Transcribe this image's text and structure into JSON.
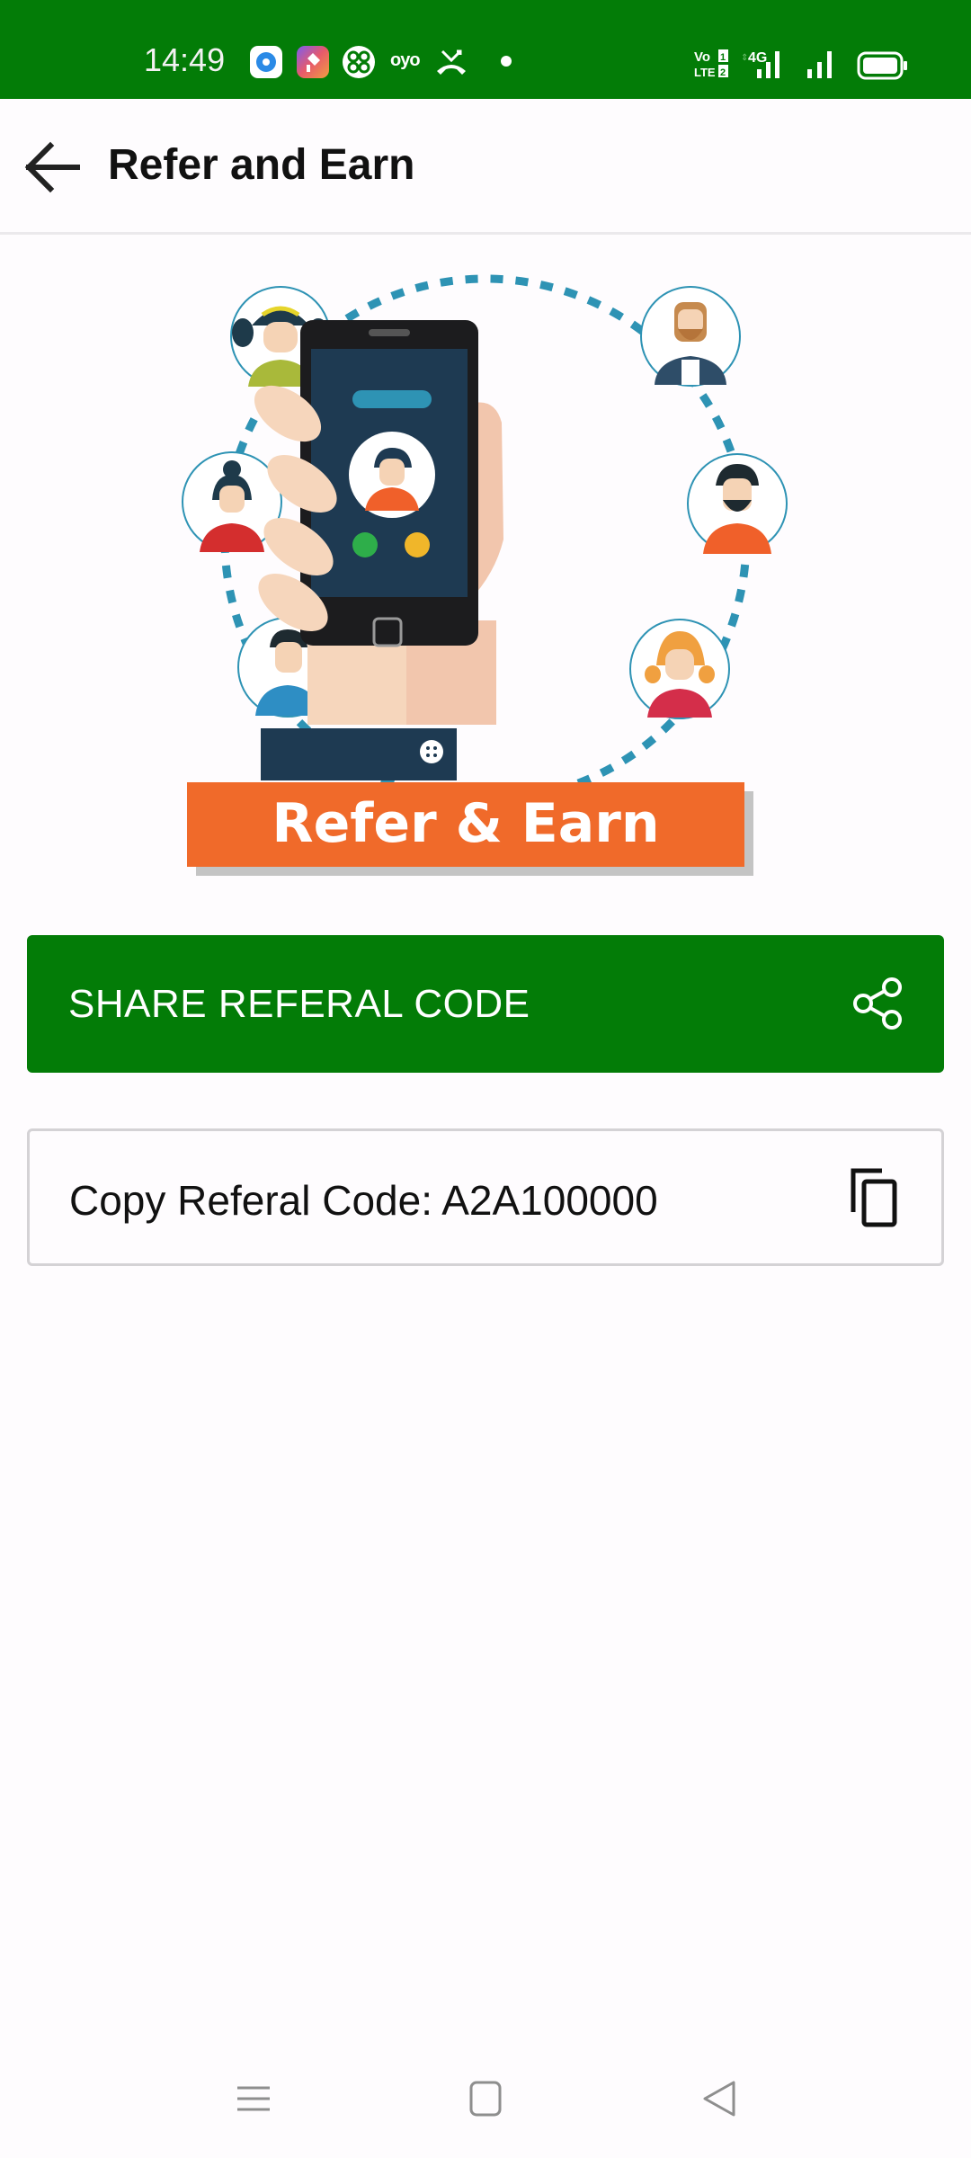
{
  "status_bar": {
    "time": "14:49",
    "left_icons": [
      "blue-app-icon",
      "gradient-app-icon",
      "clover-app-icon",
      "oyo-icon",
      "missed-call-icon",
      "notification-dot-icon"
    ],
    "oyo_label": "OYO",
    "network": {
      "volte": "VoLTE",
      "sim1_type": "4G"
    },
    "right_icons": [
      "volte-icon",
      "signal-sim1-icon",
      "signal-sim2-icon",
      "battery-icon"
    ],
    "color": "#037c07"
  },
  "header": {
    "title": "Refer and Earn",
    "back_icon": "arrow-left-icon"
  },
  "illustration": {
    "banner_text": "Refer & Earn",
    "banner_color": "#f06a2a"
  },
  "share_button": {
    "label": "SHARE REFERAL CODE",
    "icon": "share-icon",
    "color": "#037c07"
  },
  "copy_box": {
    "label": "Copy Referal Code: A2A100000",
    "code": "A2A100000",
    "icon": "copy-icon"
  },
  "navbar": {
    "buttons": [
      "menu-icon",
      "home-icon",
      "back-icon"
    ]
  }
}
